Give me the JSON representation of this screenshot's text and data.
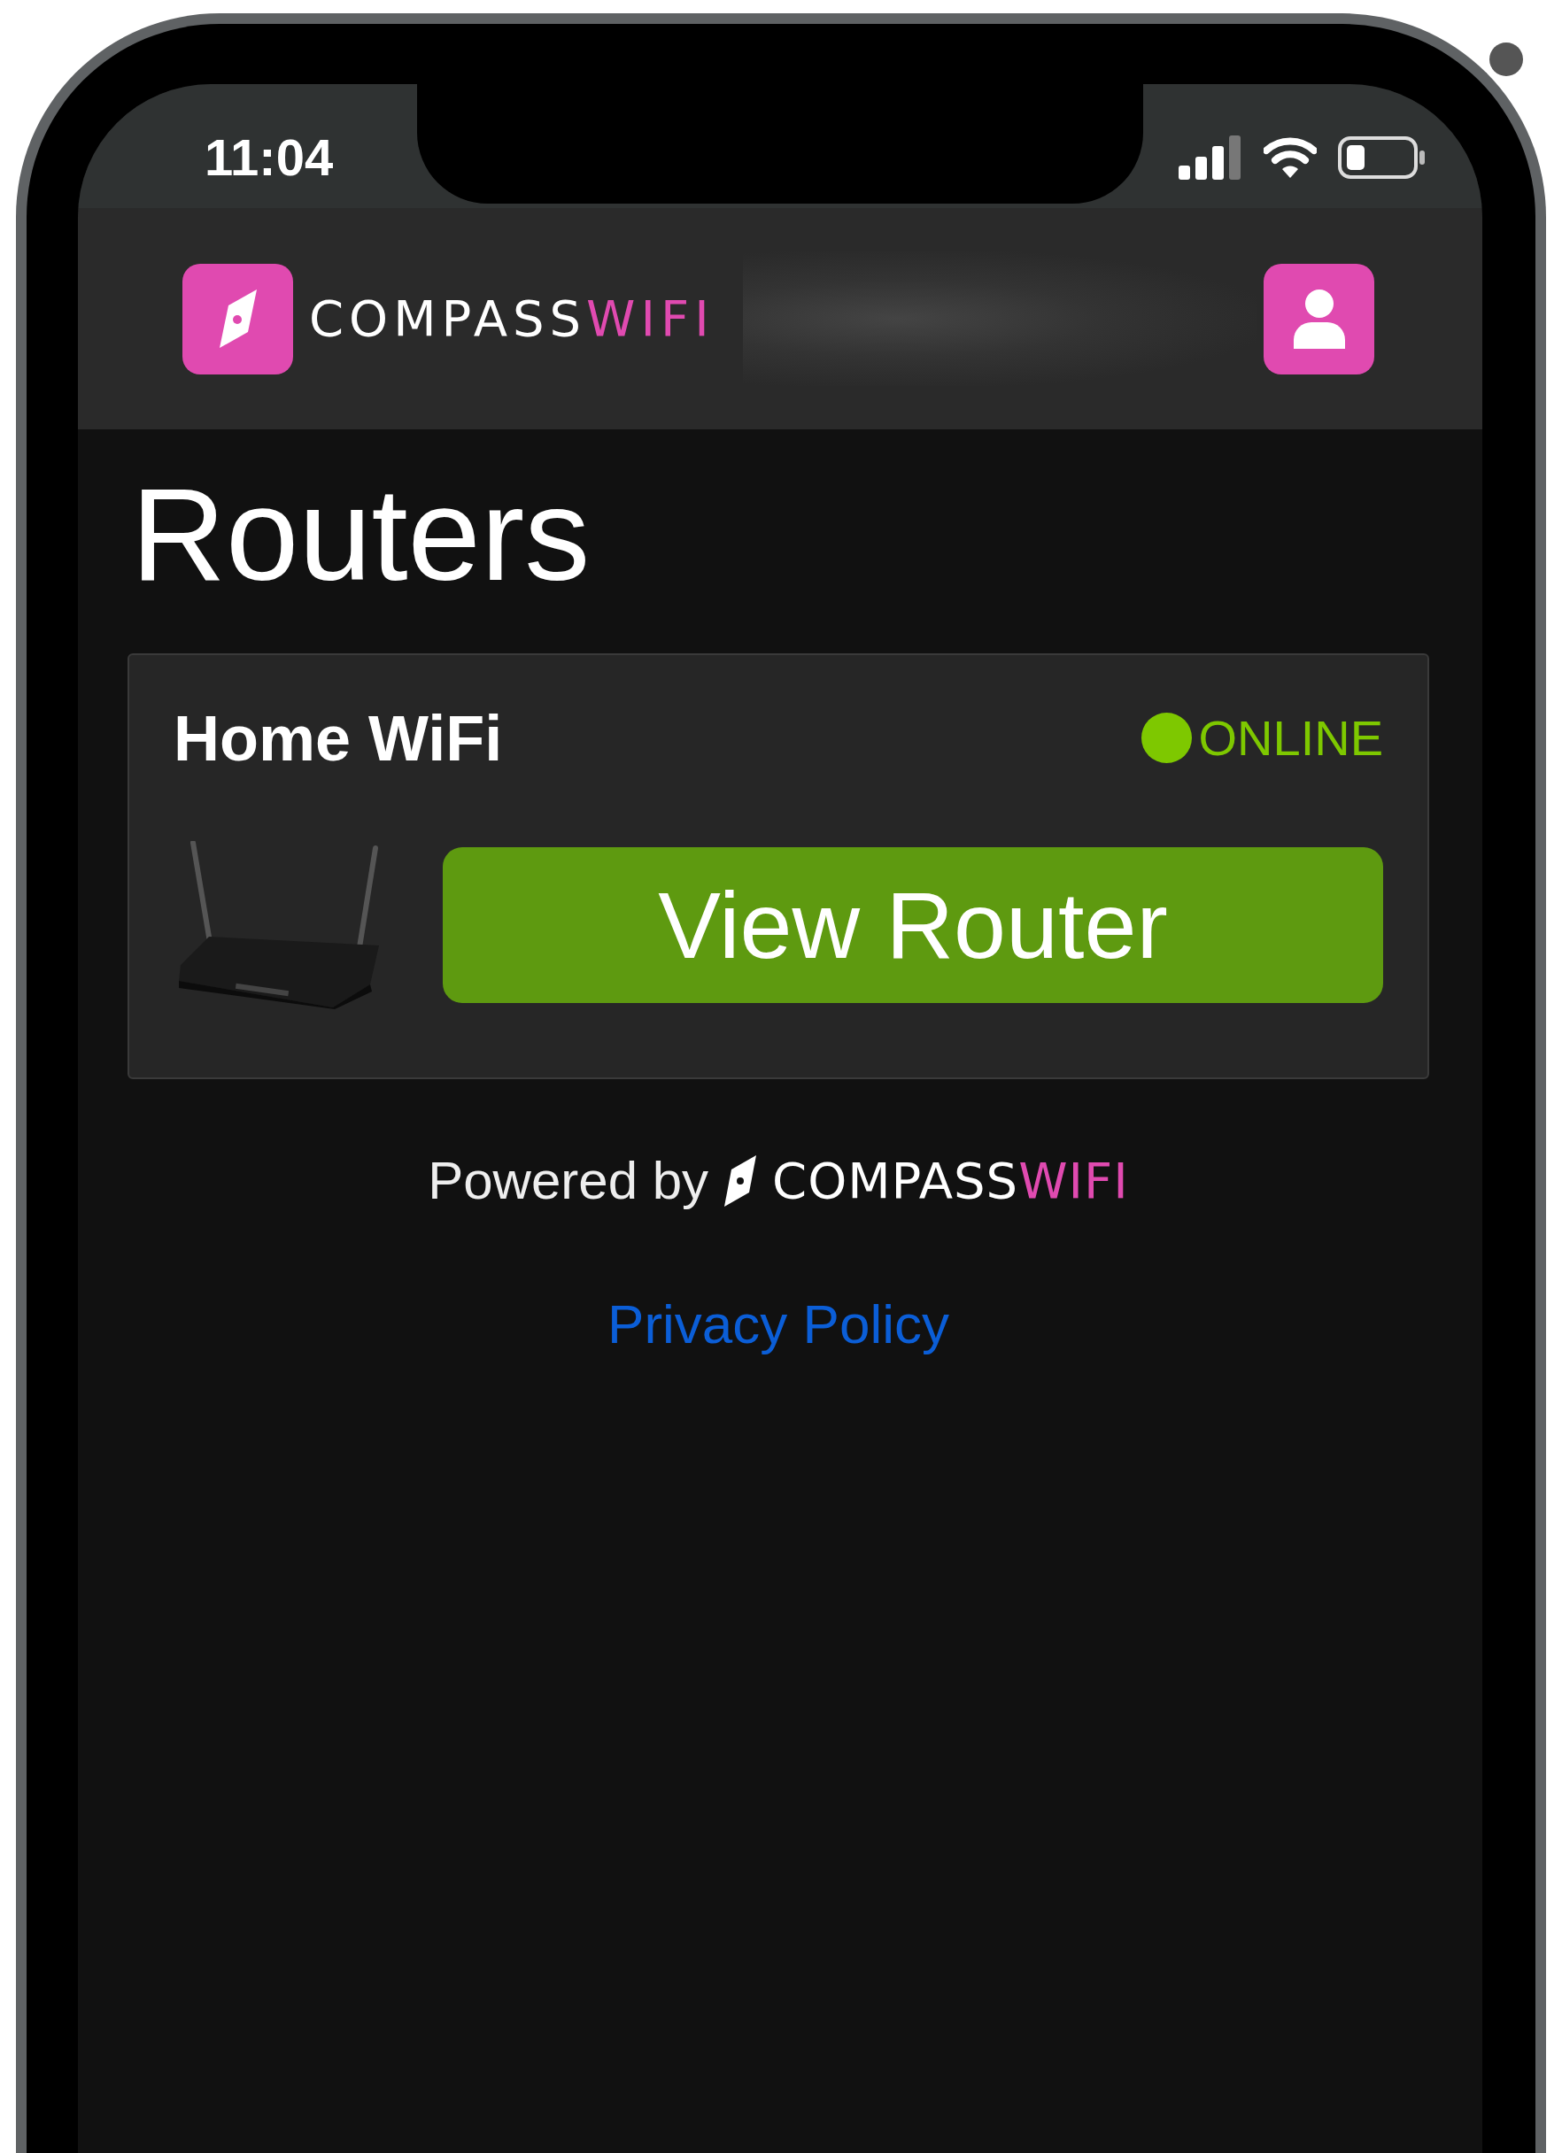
{
  "status_bar": {
    "time": "11:04"
  },
  "header": {
    "brand": {
      "first": "COMPASS",
      "second": "WIFI"
    }
  },
  "page": {
    "title": "Routers"
  },
  "routers": [
    {
      "name": "Home WiFi",
      "status": "ONLINE",
      "online": true,
      "button": "View Router"
    }
  ],
  "footer": {
    "powered_by": "Powered by",
    "brand": {
      "first": "COMPASS",
      "second": "WIFI"
    },
    "privacy_link": "Privacy Policy"
  }
}
